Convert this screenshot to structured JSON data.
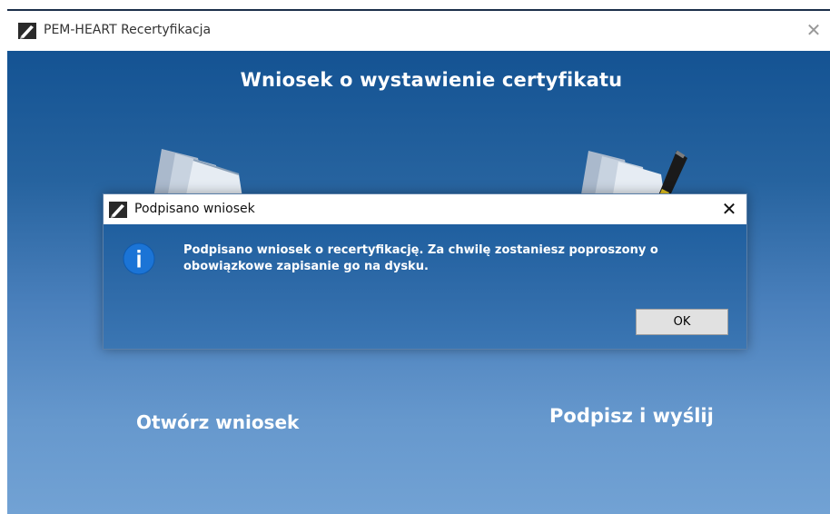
{
  "window": {
    "title": "PEM-HEART Recertyfikacja",
    "close_glyph": "✕"
  },
  "main": {
    "heading": "Wniosek o wystawienie certyfikatu",
    "open_label": "Otwórz wniosek",
    "sign_label": "Podpisz i wyślij",
    "left_icon": "documents-icon",
    "right_icon": "sign-documents-icon"
  },
  "dialog": {
    "title": "Podpisano wniosek",
    "close_glyph": "✕",
    "icon": "info-icon",
    "message_line1": "Podpisano wniosek o recertyfikację. Za chwilę zostaniesz poproszony o",
    "message_line2": "obowiązkowe zapisanie go na dysku.",
    "ok_label": "OK"
  },
  "colors": {
    "background_top": "#145393",
    "background_bottom": "#72a2d4",
    "dialog_body": "#2e6aa8",
    "info_blue": "#1b74d6"
  }
}
